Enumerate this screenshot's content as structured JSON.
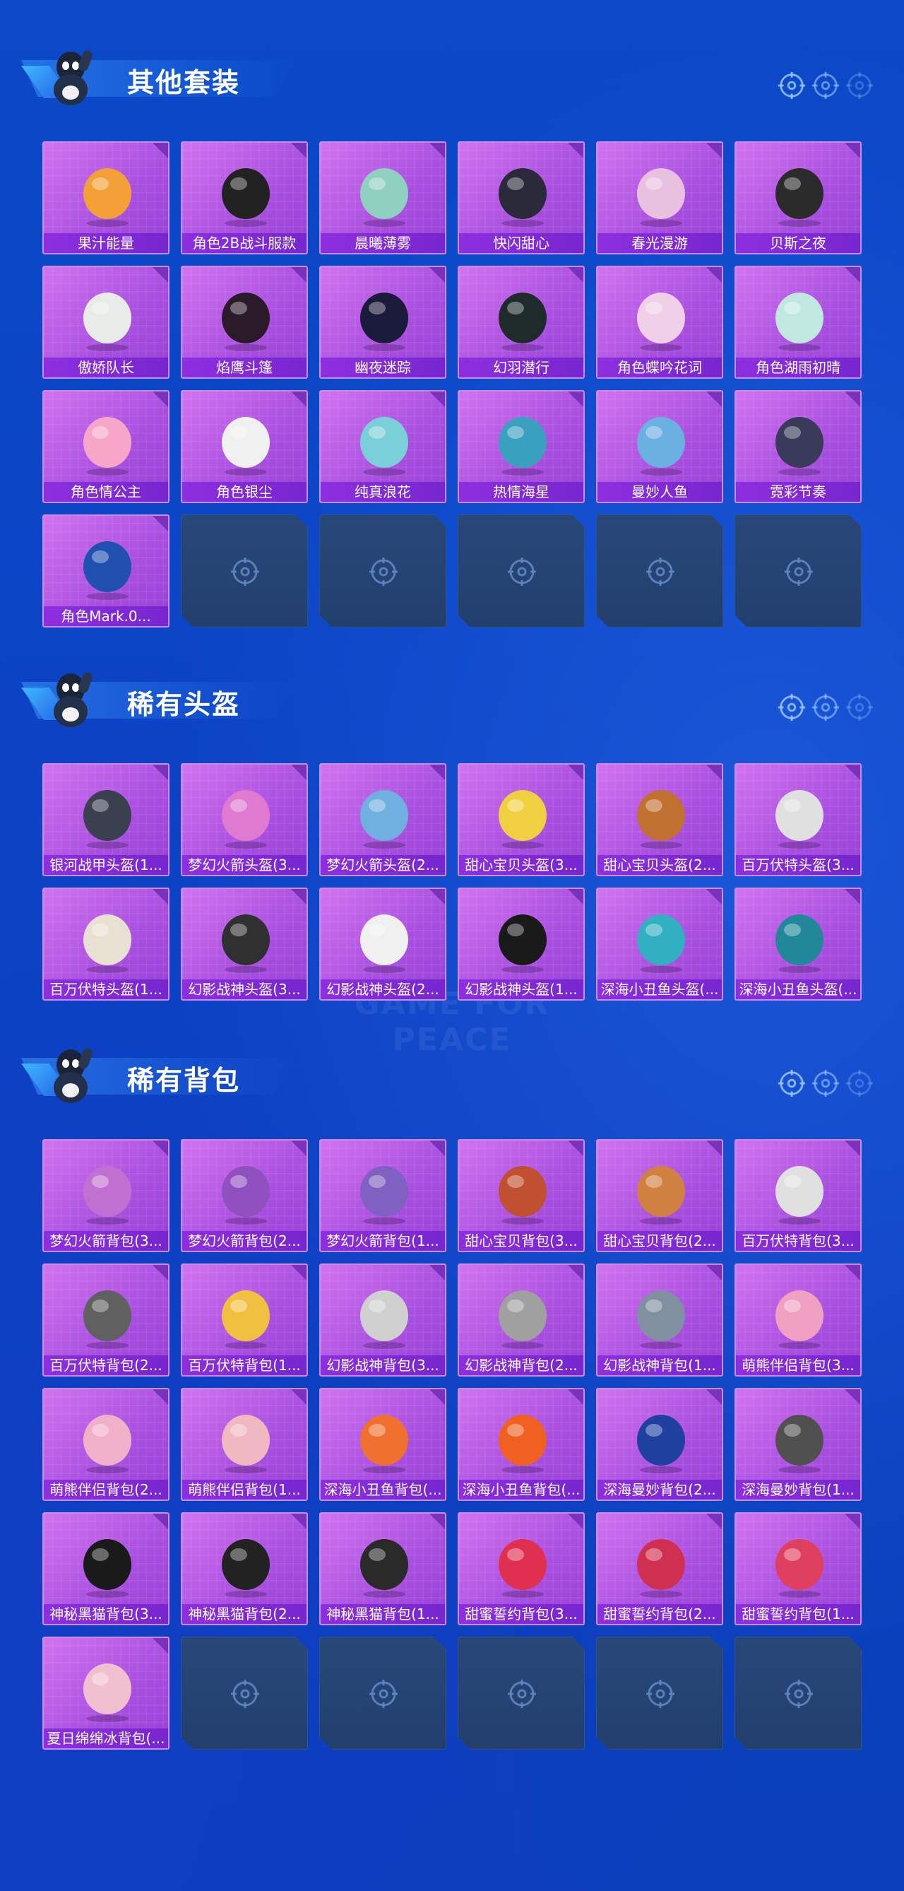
{
  "watermark_text": "GAME FOR PEACE",
  "sections": [
    {
      "title": "其他套装",
      "items": [
        "果汁能量",
        "角色2B战斗服款",
        "晨曦薄雾",
        "快闪甜心",
        "春光漫游",
        "贝斯之夜",
        "傲娇队长",
        "焰鹰斗篷",
        "幽夜迷踪",
        "幻羽潜行",
        "角色蝶吟花词",
        "角色湖雨初晴",
        "角色情公主",
        "角色银尘",
        "纯真浪花",
        "热情海星",
        "曼妙人鱼",
        "霓彩节奏",
        "角色Mark.0..."
      ],
      "art_colors": [
        "#f2a037",
        "#222222",
        "#8fd0c0",
        "#2a2a3a",
        "#e8c0e0",
        "#2b2b2b",
        "#e8ece8",
        "#2a1a2a",
        "#1a1a3a",
        "#1f2a2a",
        "#f0d0e8",
        "#c0e8e0",
        "#f7a6c8",
        "#f0f0f0",
        "#7ad0d8",
        "#3aa0c0",
        "#6ab0e0",
        "#3a3a5a",
        "#2050b0"
      ]
    },
    {
      "title": "稀有头盔",
      "items": [
        "银河战甲头盔(1...",
        "梦幻火箭头盔(3...",
        "梦幻火箭头盔(2...",
        "甜心宝贝头盔(3...",
        "甜心宝贝头盔(2...",
        "百万伏特头盔(3...",
        "百万伏特头盔(1...",
        "幻影战神头盔(3...",
        "幻影战神头盔(2...",
        "幻影战神头盔(1...",
        "深海小丑鱼头盔(...",
        "深海小丑鱼头盔(..."
      ],
      "art_colors": [
        "#3a4050",
        "#e07ad0",
        "#70b0e0",
        "#f0d040",
        "#c07030",
        "#e0e0e0",
        "#e8e0d0",
        "#303030",
        "#f0f0f0",
        "#1a1a1a",
        "#30b0c0",
        "#208898"
      ]
    },
    {
      "title": "稀有背包",
      "items": [
        "梦幻火箭背包(3...",
        "梦幻火箭背包(2...",
        "梦幻火箭背包(1...",
        "甜心宝贝背包(3...",
        "甜心宝贝背包(2...",
        "百万伏特背包(3...",
        "百万伏特背包(2...",
        "百万伏特背包(1...",
        "幻影战神背包(3...",
        "幻影战神背包(2...",
        "幻影战神背包(1...",
        "萌熊伴侣背包(3...",
        "萌熊伴侣背包(2...",
        "萌熊伴侣背包(1...",
        "深海小丑鱼背包(...",
        "深海小丑鱼背包(...",
        "深海曼妙背包(2...",
        "深海曼妙背包(1...",
        "神秘黑猫背包(3...",
        "神秘黑猫背包(2...",
        "神秘黑猫背包(1...",
        "甜蜜誓约背包(3...",
        "甜蜜誓约背包(2...",
        "甜蜜誓约背包(1...",
        "夏日绵绵冰背包(..."
      ],
      "art_colors": [
        "#c070d0",
        "#9050c0",
        "#8060c0",
        "#c05030",
        "#d08040",
        "#e0e0e0",
        "#606060",
        "#f0c040",
        "#d0d0d0",
        "#a0a0a0",
        "#8090a0",
        "#f0a0c0",
        "#f0b0c8",
        "#f0b8c0",
        "#f07030",
        "#f06020",
        "#2040a0",
        "#505050",
        "#1a1a1a",
        "#222222",
        "#2a2a2a",
        "#e03050",
        "#d03050",
        "#e04060",
        "#f0c0d0"
      ]
    }
  ]
}
